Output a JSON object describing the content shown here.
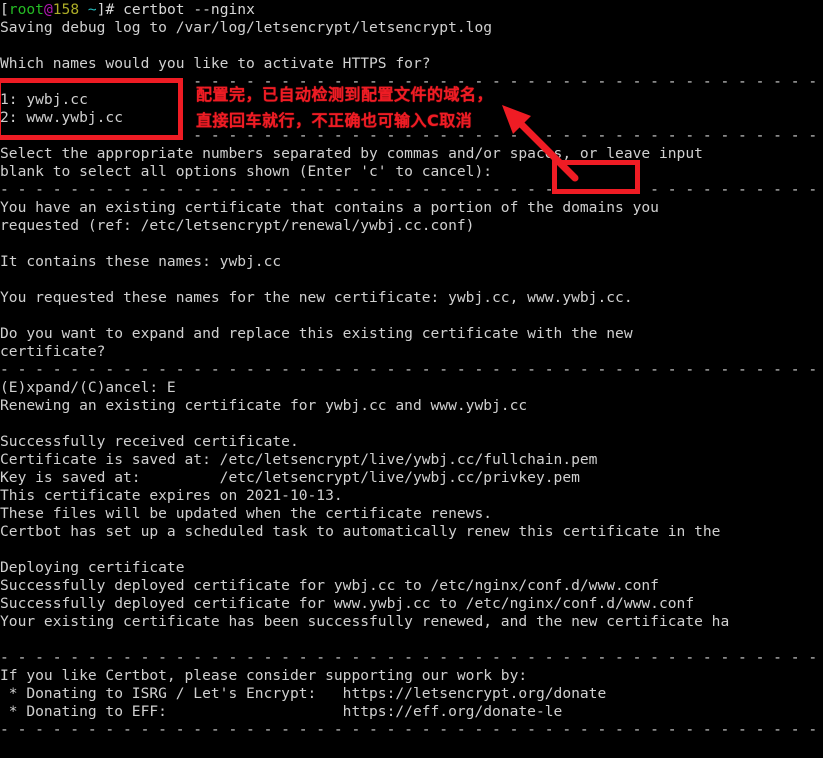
{
  "terminal": {
    "title": "certbot --nginx",
    "colors": {
      "background": "#000000",
      "foreground": "#d0d0d0",
      "prompt_user": "#25bc24",
      "prompt_at": "#b218b2",
      "prompt_host": "#adad27",
      "prompt_path": "#26bbbb",
      "annotation_red": "#ef1c24"
    },
    "prompt": {
      "bracket_open": "[",
      "user": "root",
      "at": "@",
      "host": "158",
      "path": " ~",
      "bracket_close": "]",
      "sigil": "# ",
      "command": "certbot --nginx"
    },
    "lines": {
      "l2": "Saving debug log to /var/log/letsencrypt/letsencrypt.log",
      "l4": "Which names would you like to activate HTTPS for?",
      "sep1": "- - - - - - - - - - - - - - - - - - - - - - - - - - - - - - - - - - - - - - - - - - - - - - - - - - - - - - - -",
      "l6": "1: ywbj.cc",
      "l7": "2: www.ywbj.cc",
      "sep2": "- - - - - - - - - - - - - - - - - - - - - - - - - - - - - - - - - - - - - - - - - - - - - - - - - - - - - - - -",
      "l9": "Select the appropriate numbers separated by commas and/or spaces, or leave input",
      "l10": "blank to select all options shown (Enter 'c' to cancel):",
      "sep3": "- - - - - - - - - - - - - - - - - - - - - - - - - - - - - - - - - - - - - - - - - - - - - - - - - - - - - - - -",
      "l12": "You have an existing certificate that contains a portion of the domains you",
      "l13": "requested (ref: /etc/letsencrypt/renewal/ywbj.cc.conf)",
      "l15": "It contains these names: ywbj.cc",
      "l17": "You requested these names for the new certificate: ywbj.cc, www.ywbj.cc.",
      "l19": "Do you want to expand and replace this existing certificate with the new",
      "l20": "certificate?",
      "sep4": "- - - - - - - - - - - - - - - - - - - - - - - - - - - - - - - - - - - - - - - - - - - - - - - - - - - - - - - -",
      "l22": "(E)xpand/(C)ancel: E",
      "l23": "Renewing an existing certificate for ywbj.cc and www.ywbj.cc",
      "l25": "Successfully received certificate.",
      "l26": "Certificate is saved at: /etc/letsencrypt/live/ywbj.cc/fullchain.pem",
      "l27": "Key is saved at:         /etc/letsencrypt/live/ywbj.cc/privkey.pem",
      "l28": "This certificate expires on 2021-10-13.",
      "l29": "These files will be updated when the certificate renews.",
      "l30": "Certbot has set up a scheduled task to automatically renew this certificate in the",
      "l32": "Deploying certificate",
      "l33": "Successfully deployed certificate for ywbj.cc to /etc/nginx/conf.d/www.conf",
      "l34": "Successfully deployed certificate for www.ywbj.cc to /etc/nginx/conf.d/www.conf",
      "l35": "Your existing certificate has been successfully renewed, and the new certificate ha",
      "sep5": "- - - - - - - - - - - - - - - - - - - - - - - - - - - - - - - - - - - - - - - - - - - - - - - - - - - - - - - -",
      "l37": "If you like Certbot, please consider supporting our work by:",
      "l38": " * Donating to ISRG / Let's Encrypt:   https://letsencrypt.org/donate",
      "l39": " * Donating to EFF:                    https://eff.org/donate-le",
      "sep6": "- - - - - - - - - - - - - - - - - - - - - - - - - - - - - - - - - - - - - - - - - - - - - - - - - - - - - - - -"
    }
  },
  "annotations": {
    "note_line_1": "配置完，已自动检测到配置文件的域名，",
    "note_line_2": "直接回车就行，不正确也可输入C取消",
    "domains_box_label": "domain-list-highlight",
    "cursor_box_label": "input-cursor-highlight",
    "arrow_label": "pointer-arrow"
  }
}
